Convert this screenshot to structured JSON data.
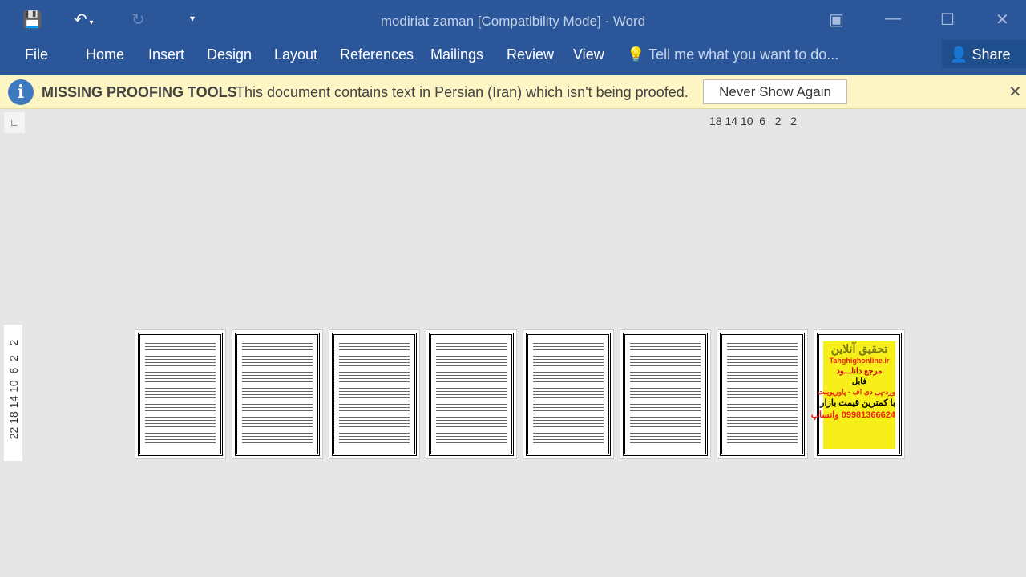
{
  "window": {
    "title": "modiriat zaman [Compatibility Mode] - Word"
  },
  "qat": {
    "save_icon": "save-icon",
    "undo_icon": "undo-icon",
    "redo_icon": "redo-icon",
    "customize_icon": "customize-qat-icon"
  },
  "ribbon": {
    "tabs": [
      "File",
      "Home",
      "Insert",
      "Design",
      "Layout",
      "References",
      "Mailings",
      "Review",
      "View"
    ],
    "tell_me": "Tell me what you want to do...",
    "share": "Share"
  },
  "message_bar": {
    "title": "MISSING PROOFING TOOLS",
    "message": "This document contains text in Persian (Iran) which isn't being proofed.",
    "button": "Never Show Again"
  },
  "rulers": {
    "horizontal": "18 14 10  6   2   2",
    "vertical": "22 18 14 10  6  2   2"
  },
  "pages": {
    "count": 8,
    "last_page_ad": [
      "تحقیق آنلاین",
      "Tahghighonline.ir",
      "مرجع دانلـــود",
      "فایل",
      "ورد-پی دی اف - پاورپوینت",
      "با کمترین قیمت بازار",
      "09981366624 واتساپ"
    ]
  },
  "colors": {
    "ribbon": "#2b579a",
    "message_bar": "#fdf6c4",
    "ad_background": "#f7ef1a"
  }
}
